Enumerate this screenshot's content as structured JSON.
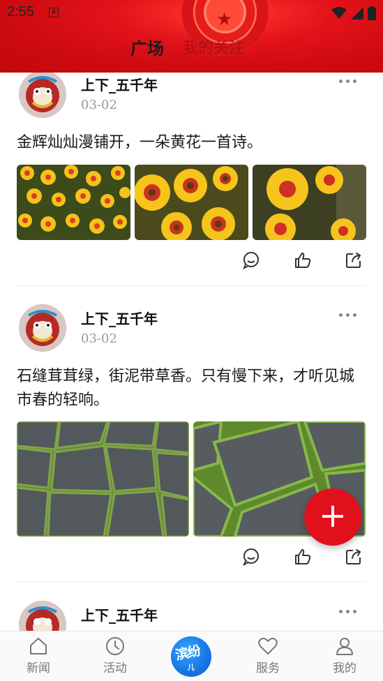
{
  "status_bar": {
    "time": "2:55",
    "notification_glyph": "A"
  },
  "header": {
    "tabs": [
      {
        "label": "广场",
        "active": true
      },
      {
        "label": "我的关注",
        "active": false
      }
    ],
    "accent_color": "#e0101c"
  },
  "posts": [
    {
      "username": "上下_五千年",
      "date": "03-02",
      "text": "金辉灿灿漫铺开，一朵黄花一首诗。",
      "images": [
        "yellow-flowers-field",
        "yellow-red-flowers-close",
        "yellow-flower-closeup"
      ]
    },
    {
      "username": "上下_五千年",
      "date": "03-02",
      "text": "石缝茸茸绿，街泥带草香。只有慢下来，才听见城市春的轻响。",
      "images": [
        "stone-path-moss",
        "stone-slabs-grass"
      ]
    },
    {
      "username": "上下_五千年",
      "date": "",
      "text": "",
      "images": []
    }
  ],
  "fab": {
    "icon": "plus-icon",
    "label": "+"
  },
  "bottom_nav": {
    "items": [
      {
        "label": "新闻",
        "icon": "house-icon"
      },
      {
        "label": "活动",
        "icon": "clock-icon"
      },
      {
        "label": "服务",
        "icon": "heart-icon"
      },
      {
        "label": "我的",
        "icon": "person-icon"
      }
    ],
    "center_logo": {
      "text": "滨纷",
      "sub": "儿"
    }
  }
}
